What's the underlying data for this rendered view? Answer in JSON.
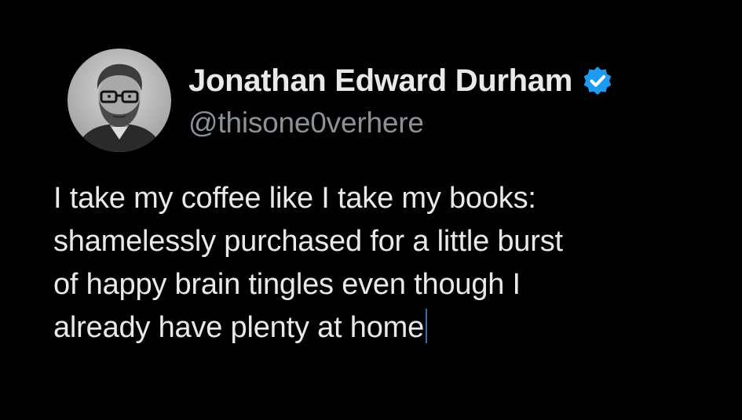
{
  "author": {
    "display_name": "Jonathan Edward Durham",
    "handle": "@thisone0verhere",
    "verified": true,
    "verified_icon": "verified-badge-icon",
    "verified_color": "#1d9bf0"
  },
  "tweet": {
    "lines": [
      "I take my coffee like I take my books:",
      "shamelessly purchased for a little burst",
      "of happy brain tingles even though I",
      "already have plenty at home"
    ]
  },
  "colors": {
    "background": "#000000",
    "primary_text": "#e7e9ea",
    "secondary_text": "#8b9196"
  }
}
